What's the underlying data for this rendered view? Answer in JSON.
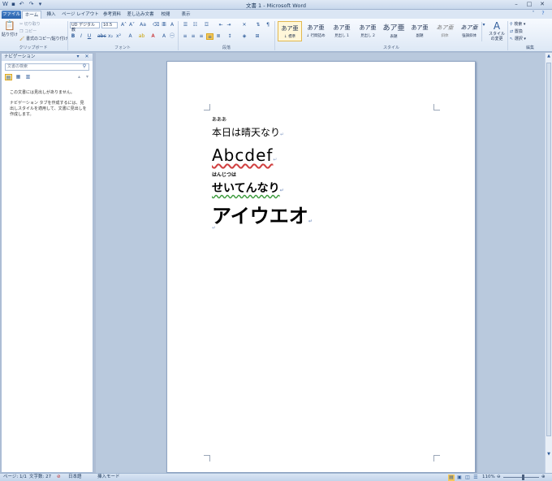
{
  "window": {
    "title": "文書 1 - Microsoft Word"
  },
  "tabs": [
    {
      "label": "ファイル"
    },
    {
      "label": "ホーム"
    },
    {
      "label": "挿入"
    },
    {
      "label": "ページ レイアウト"
    },
    {
      "label": "参考資料"
    },
    {
      "label": "差し込み文書"
    },
    {
      "label": "校閲"
    },
    {
      "label": "表示"
    }
  ],
  "ribbon": {
    "clipboard": {
      "paste": "貼り付け",
      "cut": "切り取り",
      "copy": "コピー",
      "format_painter": "書式のコピー/貼り付け",
      "group": "クリップボード"
    },
    "font": {
      "name": "UD デジタル 教",
      "size": "10.5",
      "group": "フォント"
    },
    "paragraph": {
      "group": "段落"
    },
    "styles": {
      "items": [
        {
          "sample": "あア亜",
          "name": "↓ 標準"
        },
        {
          "sample": "あア亜",
          "name": "↓ 行間詰め"
        },
        {
          "sample": "あア亜",
          "name": "見出し 1"
        },
        {
          "sample": "あア亜",
          "name": "見出し 2"
        },
        {
          "sample": "あア亜",
          "name": "表題"
        },
        {
          "sample": "あア亜",
          "name": "副題"
        },
        {
          "sample": "あア亜",
          "name": "斜体"
        },
        {
          "sample": "あア亜",
          "name": "強調斜体"
        }
      ],
      "change_styles": "スタイルの変更",
      "group": "スタイル"
    },
    "editing": {
      "find": "検索",
      "replace": "置換",
      "select": "選択",
      "group": "編集"
    }
  },
  "navigation": {
    "title": "ナビゲーション",
    "search_placeholder": "文書の検索",
    "message_1": "この文書には見出しがありません。",
    "message_2": "ナビゲーション タブを作成するには、見出しスタイルを適用して、文書に見出しを作成します。"
  },
  "document": {
    "ruby_1": "あああ",
    "line_1": "本日は晴天なり",
    "line_2": "Abcdef",
    "ruby_2": "はんじつは",
    "line_3": "せいてんなり",
    "line_4": "アイウエオ"
  },
  "status": {
    "page": "ページ: 1/1",
    "words": "文字数: 27",
    "language": "日本語",
    "mode": "挿入モード",
    "zoom": "110%"
  }
}
